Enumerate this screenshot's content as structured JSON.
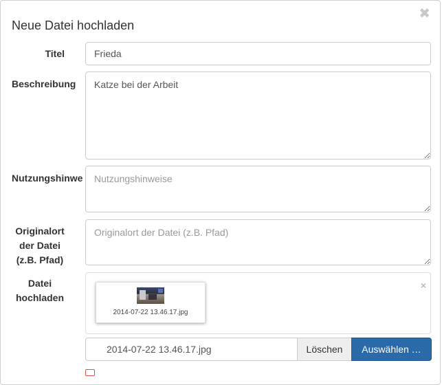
{
  "dialog": {
    "title": "Neue Datei hochladen",
    "close_glyph": "✖"
  },
  "form": {
    "title_label": "Titel",
    "title_value": "Frieda",
    "description_label": "Beschreibung",
    "description_value": "Katze bei der Arbeit",
    "usage_label": "Nutzungshinwe",
    "usage_placeholder": "Nutzungshinweise",
    "origin_label_lines": [
      "Originalort",
      "der Datei",
      "(z.B. Pfad)"
    ],
    "origin_placeholder": "Originalort der Datei (z.B. Pfad)",
    "upload_label_lines": [
      "Datei",
      "hochladen"
    ]
  },
  "upload": {
    "preview_filename": "2014-07-22 13.46.17.jpg",
    "remove_glyph": "×",
    "selected_file": "2014-07-22 13.46.17.jpg",
    "delete_button": "Löschen",
    "choose_button": "Auswählen …"
  },
  "colors": {
    "primary_button": "#2b6aa8",
    "default_button": "#eeeeee"
  }
}
